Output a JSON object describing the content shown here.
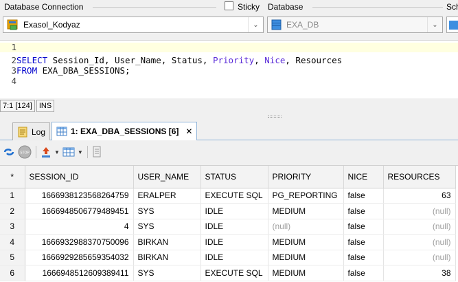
{
  "connection": {
    "label": "Database Connection",
    "sticky_label": "Sticky",
    "database_label": "Database",
    "schema_label_partial": "Sch",
    "connection_value": "Exasol_Kodyaz",
    "database_value": "EXA_DB"
  },
  "editor": {
    "lines": [
      {
        "num": "1",
        "segments": []
      },
      {
        "num": "2",
        "segments": [
          {
            "t": "SELECT",
            "c": "kw"
          },
          {
            "t": " Session_Id, User_Name, Status, ",
            "c": ""
          },
          {
            "t": "Priority",
            "c": "kw2"
          },
          {
            "t": ", ",
            "c": ""
          },
          {
            "t": "Nice",
            "c": "kw2"
          },
          {
            "t": ", Resources",
            "c": ""
          }
        ]
      },
      {
        "num": "3",
        "segments": [
          {
            "t": "FROM",
            "c": "kw"
          },
          {
            "t": " EXA_DBA_SESSIONS;",
            "c": ""
          }
        ]
      },
      {
        "num": "4",
        "segments": []
      }
    ]
  },
  "status": {
    "position": "7:1 [124]",
    "mode": "INS"
  },
  "tabs": [
    {
      "label": "Log",
      "active": false
    },
    {
      "label": "1: EXA_DBA_SESSIONS [6]",
      "active": true
    }
  ],
  "close_glyph": "✕",
  "grid": {
    "corner": "*",
    "columns": [
      "SESSION_ID",
      "USER_NAME",
      "STATUS",
      "PRIORITY",
      "NICE",
      "RESOURCES"
    ],
    "rows": [
      {
        "n": "1",
        "cells": [
          "1666938123568264759",
          "ERALPER",
          "EXECUTE SQL",
          "PG_REPORTING",
          "false",
          "63"
        ]
      },
      {
        "n": "2",
        "cells": [
          "1666948506779489451",
          "SYS",
          "IDLE",
          "MEDIUM",
          "false",
          "(null)"
        ]
      },
      {
        "n": "3",
        "cells": [
          "4",
          "SYS",
          "IDLE",
          "(null)",
          "false",
          "(null)"
        ]
      },
      {
        "n": "4",
        "cells": [
          "1666932988370750096",
          "BIRKAN",
          "IDLE",
          "MEDIUM",
          "false",
          "(null)"
        ]
      },
      {
        "n": "5",
        "cells": [
          "1666929285659354032",
          "BIRKAN",
          "IDLE",
          "MEDIUM",
          "false",
          "(null)"
        ]
      },
      {
        "n": "6",
        "cells": [
          "1666948512609389411",
          "SYS",
          "EXECUTE SQL",
          "MEDIUM",
          "false",
          "38"
        ]
      }
    ]
  },
  "colors": {
    "keyword": "#0000cc",
    "function_keyword": "#5a2bd8",
    "null_text": "#a0a0a0",
    "tab_accent": "#8fb3d9",
    "current_line": "#ffffe0"
  },
  "icons": [
    "database-connection-icon",
    "database-icon",
    "log-icon",
    "table-icon",
    "refresh-icon",
    "stop-icon",
    "export-icon",
    "grid-view-icon",
    "record-view-icon"
  ]
}
